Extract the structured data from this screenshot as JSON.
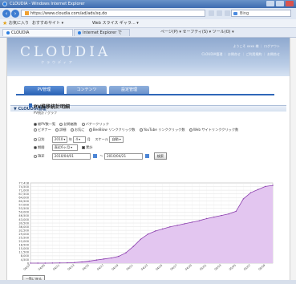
{
  "window": {
    "title": "CLOUDIA - Windows Internet Explorer"
  },
  "browser": {
    "url": "https://www.cloudia.com/ad/ads/sq.do",
    "search_placeholder": "Bing",
    "favorites_label": "お気に入り",
    "suggested_sites": "おすすめサイト ▾",
    "web_slice": "Web スライス ギャラ... ▾",
    "tabs": [
      "CLOUDIA",
      "Internet Explorer では..."
    ],
    "command_bar": "ページ(P) ▾ セーフティ(S) ▾ ツール(O) ▾"
  },
  "header": {
    "logo": "CLOUDIA",
    "logo_sub": "クラウディア",
    "info": "ようこそ xxxx 様 ｜ ログアウト",
    "links": "CLOUDIA管理 ｜ お問合せ ｜ ご利用規約 ｜ お問合せ"
  },
  "section": {
    "title": "▼ CLOUDIA管理"
  },
  "menu_tabs": [
    "PV管理",
    "コンテンツ",
    "設定管理"
  ],
  "report": {
    "title": "PV推移統計明細",
    "breadcrumb": "PV統計 / グラフ"
  },
  "options": {
    "row1": [
      "総PV数一覧",
      "訪問者数",
      "バナークリック"
    ],
    "row2": [
      "ビギナー",
      "詳細",
      "お気に",
      "BeeBiow リンククリック数",
      "YouTube リンククリック数",
      "Web サイトリンククリック数"
    ],
    "date_label": "日別",
    "year": "2010",
    "year_suffix": "年",
    "month": "4",
    "month_suffix": "月",
    "scale_label": "スケール",
    "scale_value": "自動",
    "period_label": "期間",
    "period_value": "直近6ヶ月",
    "cumulative_label": "累計",
    "range_label": "指定",
    "range_from": "2010/04/01",
    "range_sep": "～",
    "range_to": "2010/04/21",
    "search_button": "検索"
  },
  "chart_data": {
    "type": "area",
    "x": [
      "04/07",
      "04/08",
      "04/09",
      "04/10",
      "04/11",
      "04/12",
      "04/13",
      "04/14",
      "04/15",
      "04/16",
      "04/17",
      "04/18",
      "04/19",
      "04/20",
      "04/21",
      "04/22",
      "04/23",
      "04/24",
      "04/25",
      "04/26",
      "04/27",
      "04/28",
      "04/29",
      "04/30",
      "05/01",
      "05/02",
      "05/03",
      "05/04",
      "05/05",
      "05/06",
      "05/07",
      "05/08",
      "05/09",
      "05/10"
    ],
    "y": [
      0,
      0,
      0,
      100,
      200,
      300,
      600,
      1200,
      2000,
      3000,
      4000,
      5000,
      6500,
      10000,
      16000,
      23000,
      28000,
      31000,
      33000,
      35000,
      36500,
      38000,
      39500,
      41000,
      43000,
      44500,
      46000,
      47500,
      50000,
      62000,
      68000,
      71000,
      74000,
      75000
    ],
    "y_ticks": [
      "77,418",
      "74,500",
      "71,000",
      "67,500",
      "64,000",
      "60,500",
      "57,000",
      "53,500",
      "50,000",
      "46,500",
      "43,000",
      "39,500",
      "36,000",
      "32,500",
      "29,000",
      "25,500",
      "22,000",
      "18,500",
      "15,000",
      "11,500",
      "8,000",
      "4,500",
      "0"
    ],
    "x_tick_labels": [
      "04/07",
      "04/09",
      "04/11",
      "04/13",
      "04/15",
      "04/17",
      "04/19",
      "04/21",
      "04/23",
      "04/25",
      "04/27",
      "04/29",
      "05/01",
      "05/03",
      "05/05",
      "05/07",
      "05/09"
    ],
    "ylim": [
      0,
      77418
    ],
    "grid": true,
    "fill_color": "#e3c6f0",
    "line_color": "#8b3fae"
  },
  "bottom_button": "一覧に戻る"
}
